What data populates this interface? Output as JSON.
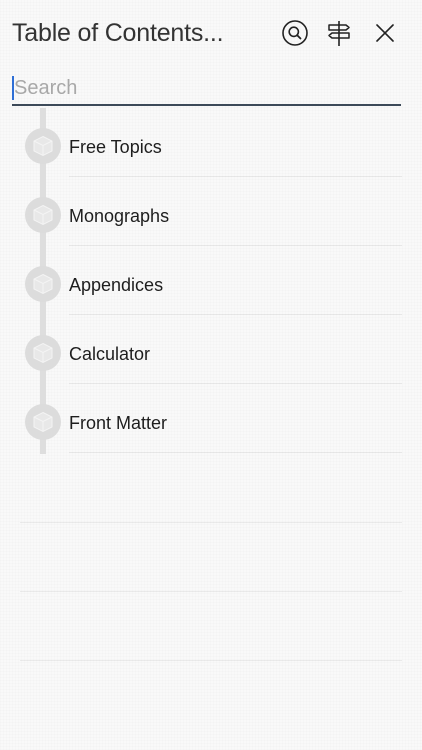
{
  "header": {
    "title": "Table of Contents...",
    "icons": {
      "search": "search-circle-icon",
      "signpost": "signpost-icon",
      "close": "close-icon"
    }
  },
  "search": {
    "placeholder": "Search",
    "value": ""
  },
  "toc": {
    "items": [
      {
        "label": "Free Topics",
        "icon": "cube-icon"
      },
      {
        "label": "Monographs",
        "icon": "cube-icon"
      },
      {
        "label": "Appendices",
        "icon": "cube-icon"
      },
      {
        "label": "Calculator",
        "icon": "cube-icon"
      },
      {
        "label": "Front Matter",
        "icon": "cube-icon"
      }
    ]
  },
  "colors": {
    "accent_caret": "#2f6fd6",
    "search_underline": "#3d4a59",
    "timeline": "#dedede",
    "node": "#dcdcdc"
  }
}
